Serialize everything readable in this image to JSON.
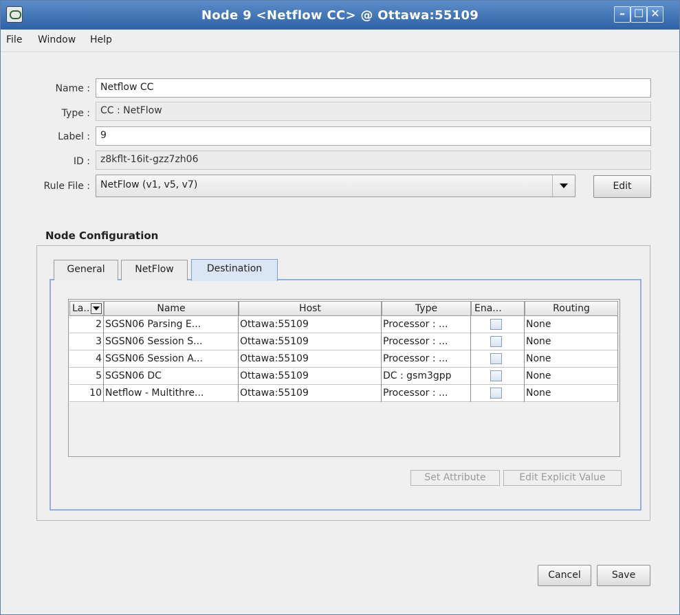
{
  "window": {
    "title": "Node 9 <Netflow CC> @ Ottawa:55109",
    "minimize_label": "–",
    "maximize_label": "☐",
    "close_label": "✕"
  },
  "menu": {
    "file": "File",
    "window": "Window",
    "help": "Help"
  },
  "form": {
    "name_label": "Name :",
    "name_value": "Netflow CC",
    "type_label": "Type :",
    "type_value": "CC : NetFlow",
    "label_label": "Label :",
    "label_value": "9",
    "id_label": "ID :",
    "id_value": "z8kflt-16it-gzz7zh06",
    "rule_file_label": "Rule File :",
    "rule_file_value": "NetFlow (v1, v5, v7)",
    "edit_button": "Edit"
  },
  "config": {
    "section_title": "Node Configuration",
    "tabs": [
      "General",
      "NetFlow",
      "Destination"
    ],
    "active_tab": "Destination",
    "columns": [
      "La...",
      "Name",
      "Host",
      "Type",
      "Ena...",
      "Routing"
    ],
    "rows": [
      {
        "label": "2",
        "name": "SGSN06 Parsing E...",
        "host": "Ottawa:55109",
        "type": "Processor : ...",
        "enabled": false,
        "routing": "None"
      },
      {
        "label": "3",
        "name": "SGSN06 Session S...",
        "host": "Ottawa:55109",
        "type": "Processor : ...",
        "enabled": false,
        "routing": "None"
      },
      {
        "label": "4",
        "name": "SGSN06 Session A...",
        "host": "Ottawa:55109",
        "type": "Processor : ...",
        "enabled": false,
        "routing": "None"
      },
      {
        "label": "5",
        "name": "SGSN06 DC",
        "host": "Ottawa:55109",
        "type": "DC : gsm3gpp",
        "enabled": false,
        "routing": "None"
      },
      {
        "label": "10",
        "name": "Netflow - Multithre...",
        "host": "Ottawa:55109",
        "type": "Processor : ...",
        "enabled": false,
        "routing": "None"
      }
    ],
    "set_attribute_button": "Set Attribute",
    "edit_explicit_value_button": "Edit Explicit Value"
  },
  "footer": {
    "cancel_button": "Cancel",
    "save_button": "Save"
  }
}
